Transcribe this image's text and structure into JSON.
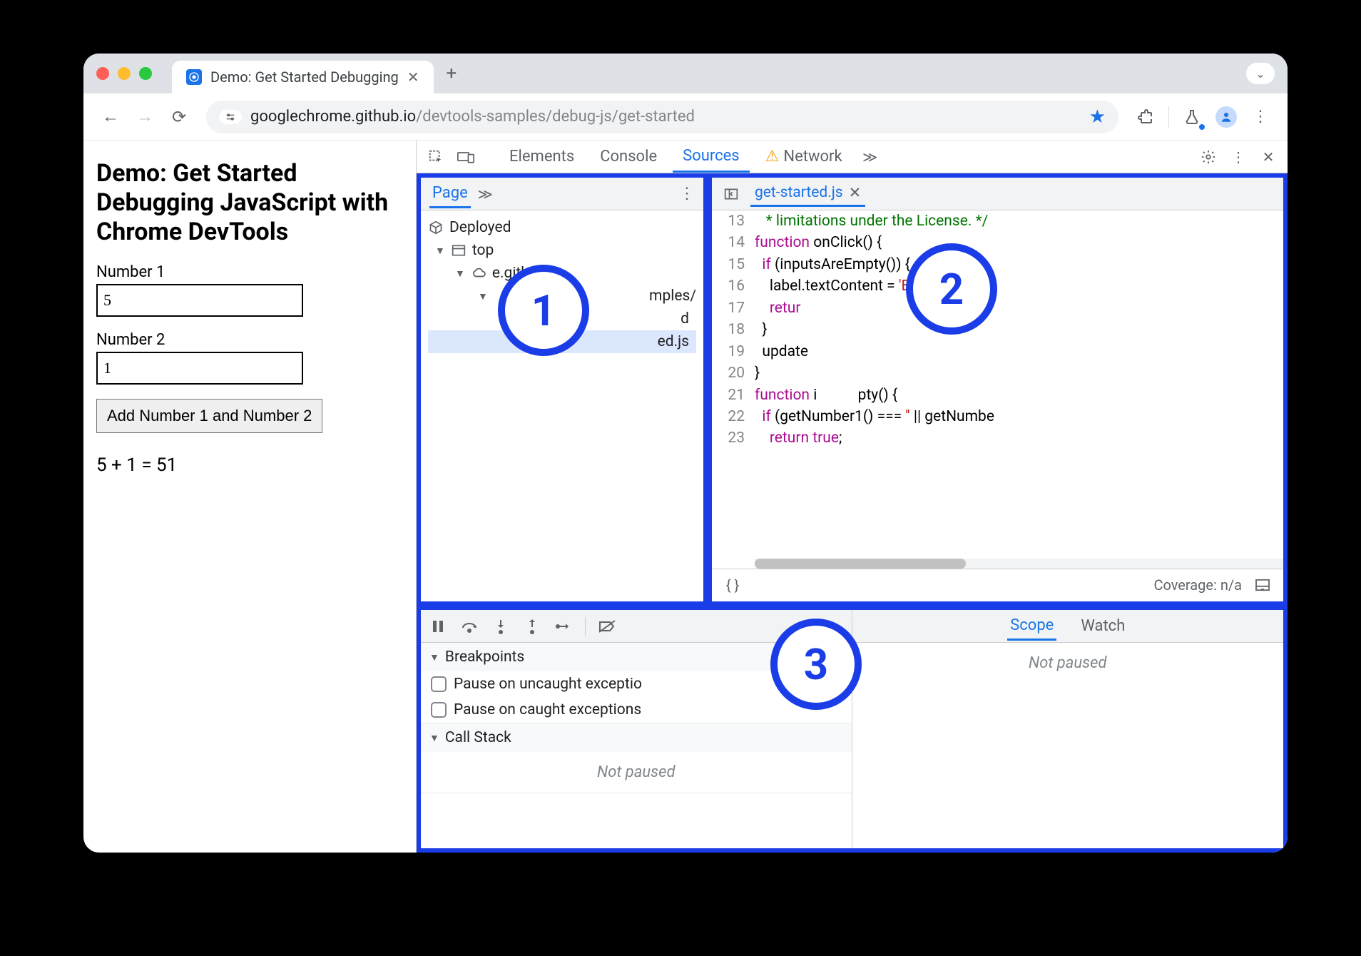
{
  "browser": {
    "tab_title": "Demo: Get Started Debugging",
    "url_host": "googlechrome.github.io",
    "url_path": "/devtools-samples/debug-js/get-started"
  },
  "page": {
    "heading": "Demo: Get Started Debugging JavaScript with Chrome DevTools",
    "num1_label": "Number 1",
    "num1_value": "5",
    "num2_label": "Number 2",
    "num2_value": "1",
    "button_label": "Add Number 1 and Number 2",
    "result": "5 + 1 = 51"
  },
  "devtools": {
    "tabs": {
      "elements": "Elements",
      "console": "Console",
      "sources": "Sources",
      "network": "Network"
    },
    "navigator": {
      "tab": "Page",
      "deployed": "Deployed",
      "top": "top",
      "host_fragment": "e.github",
      "folder_fragment": "mples/",
      "file_selected": "ed.js"
    },
    "editor": {
      "filename": "get-started.js",
      "coverage": "Coverage: n/a",
      "lines": [
        {
          "n": 13,
          "html": "<span class='cm'>   * limitations under the License. */</span>"
        },
        {
          "n": 14,
          "html": "<span class='kw'>function</span> <span class='fn'>onClick</span>() {"
        },
        {
          "n": 15,
          "html": "  <span class='kw'>if</span> (inputsAreEmpty()) {"
        },
        {
          "n": 16,
          "html": "    label.textContent = <span class='str'>'Error: one o</span>"
        },
        {
          "n": 17,
          "html": "    <span class='kw'>retur</span>"
        },
        {
          "n": 18,
          "html": "  }"
        },
        {
          "n": 19,
          "html": "  update"
        },
        {
          "n": 20,
          "html": "}"
        },
        {
          "n": 21,
          "html": "<span class='kw'>function</span> i           pty() {"
        },
        {
          "n": 22,
          "html": "  <span class='kw'>if</span> (getNumber1() === <span class='str'>''</span> || getNumbe"
        },
        {
          "n": 23,
          "html": "    <span class='kw'>return</span> <span class='kw'>true</span>;"
        }
      ]
    },
    "debugger": {
      "breakpoints_label": "Breakpoints",
      "pause_uncaught": "Pause on uncaught exceptio",
      "pause_caught": "Pause on caught exceptions",
      "callstack_label": "Call Stack",
      "not_paused": "Not paused",
      "scope_tab": "Scope",
      "watch_tab": "Watch"
    }
  },
  "annotations": {
    "b1": "1",
    "b2": "2",
    "b3": "3"
  }
}
